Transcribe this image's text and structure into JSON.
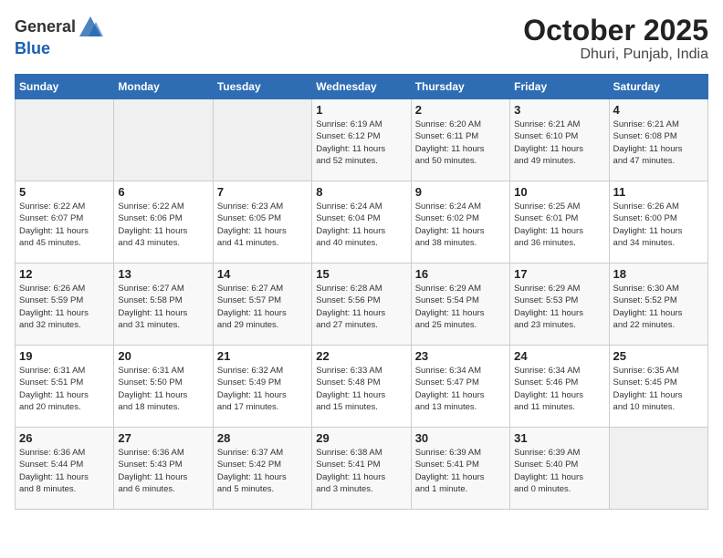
{
  "header": {
    "logo_general": "General",
    "logo_blue": "Blue",
    "title": "October 2025",
    "subtitle": "Dhuri, Punjab, India"
  },
  "days_of_week": [
    "Sunday",
    "Monday",
    "Tuesday",
    "Wednesday",
    "Thursday",
    "Friday",
    "Saturday"
  ],
  "weeks": [
    [
      {
        "day": "",
        "info": ""
      },
      {
        "day": "",
        "info": ""
      },
      {
        "day": "",
        "info": ""
      },
      {
        "day": "1",
        "info": "Sunrise: 6:19 AM\nSunset: 6:12 PM\nDaylight: 11 hours\nand 52 minutes."
      },
      {
        "day": "2",
        "info": "Sunrise: 6:20 AM\nSunset: 6:11 PM\nDaylight: 11 hours\nand 50 minutes."
      },
      {
        "day": "3",
        "info": "Sunrise: 6:21 AM\nSunset: 6:10 PM\nDaylight: 11 hours\nand 49 minutes."
      },
      {
        "day": "4",
        "info": "Sunrise: 6:21 AM\nSunset: 6:08 PM\nDaylight: 11 hours\nand 47 minutes."
      }
    ],
    [
      {
        "day": "5",
        "info": "Sunrise: 6:22 AM\nSunset: 6:07 PM\nDaylight: 11 hours\nand 45 minutes."
      },
      {
        "day": "6",
        "info": "Sunrise: 6:22 AM\nSunset: 6:06 PM\nDaylight: 11 hours\nand 43 minutes."
      },
      {
        "day": "7",
        "info": "Sunrise: 6:23 AM\nSunset: 6:05 PM\nDaylight: 11 hours\nand 41 minutes."
      },
      {
        "day": "8",
        "info": "Sunrise: 6:24 AM\nSunset: 6:04 PM\nDaylight: 11 hours\nand 40 minutes."
      },
      {
        "day": "9",
        "info": "Sunrise: 6:24 AM\nSunset: 6:02 PM\nDaylight: 11 hours\nand 38 minutes."
      },
      {
        "day": "10",
        "info": "Sunrise: 6:25 AM\nSunset: 6:01 PM\nDaylight: 11 hours\nand 36 minutes."
      },
      {
        "day": "11",
        "info": "Sunrise: 6:26 AM\nSunset: 6:00 PM\nDaylight: 11 hours\nand 34 minutes."
      }
    ],
    [
      {
        "day": "12",
        "info": "Sunrise: 6:26 AM\nSunset: 5:59 PM\nDaylight: 11 hours\nand 32 minutes."
      },
      {
        "day": "13",
        "info": "Sunrise: 6:27 AM\nSunset: 5:58 PM\nDaylight: 11 hours\nand 31 minutes."
      },
      {
        "day": "14",
        "info": "Sunrise: 6:27 AM\nSunset: 5:57 PM\nDaylight: 11 hours\nand 29 minutes."
      },
      {
        "day": "15",
        "info": "Sunrise: 6:28 AM\nSunset: 5:56 PM\nDaylight: 11 hours\nand 27 minutes."
      },
      {
        "day": "16",
        "info": "Sunrise: 6:29 AM\nSunset: 5:54 PM\nDaylight: 11 hours\nand 25 minutes."
      },
      {
        "day": "17",
        "info": "Sunrise: 6:29 AM\nSunset: 5:53 PM\nDaylight: 11 hours\nand 23 minutes."
      },
      {
        "day": "18",
        "info": "Sunrise: 6:30 AM\nSunset: 5:52 PM\nDaylight: 11 hours\nand 22 minutes."
      }
    ],
    [
      {
        "day": "19",
        "info": "Sunrise: 6:31 AM\nSunset: 5:51 PM\nDaylight: 11 hours\nand 20 minutes."
      },
      {
        "day": "20",
        "info": "Sunrise: 6:31 AM\nSunset: 5:50 PM\nDaylight: 11 hours\nand 18 minutes."
      },
      {
        "day": "21",
        "info": "Sunrise: 6:32 AM\nSunset: 5:49 PM\nDaylight: 11 hours\nand 17 minutes."
      },
      {
        "day": "22",
        "info": "Sunrise: 6:33 AM\nSunset: 5:48 PM\nDaylight: 11 hours\nand 15 minutes."
      },
      {
        "day": "23",
        "info": "Sunrise: 6:34 AM\nSunset: 5:47 PM\nDaylight: 11 hours\nand 13 minutes."
      },
      {
        "day": "24",
        "info": "Sunrise: 6:34 AM\nSunset: 5:46 PM\nDaylight: 11 hours\nand 11 minutes."
      },
      {
        "day": "25",
        "info": "Sunrise: 6:35 AM\nSunset: 5:45 PM\nDaylight: 11 hours\nand 10 minutes."
      }
    ],
    [
      {
        "day": "26",
        "info": "Sunrise: 6:36 AM\nSunset: 5:44 PM\nDaylight: 11 hours\nand 8 minutes."
      },
      {
        "day": "27",
        "info": "Sunrise: 6:36 AM\nSunset: 5:43 PM\nDaylight: 11 hours\nand 6 minutes."
      },
      {
        "day": "28",
        "info": "Sunrise: 6:37 AM\nSunset: 5:42 PM\nDaylight: 11 hours\nand 5 minutes."
      },
      {
        "day": "29",
        "info": "Sunrise: 6:38 AM\nSunset: 5:41 PM\nDaylight: 11 hours\nand 3 minutes."
      },
      {
        "day": "30",
        "info": "Sunrise: 6:39 AM\nSunset: 5:41 PM\nDaylight: 11 hours\nand 1 minute."
      },
      {
        "day": "31",
        "info": "Sunrise: 6:39 AM\nSunset: 5:40 PM\nDaylight: 11 hours\nand 0 minutes."
      },
      {
        "day": "",
        "info": ""
      }
    ]
  ]
}
